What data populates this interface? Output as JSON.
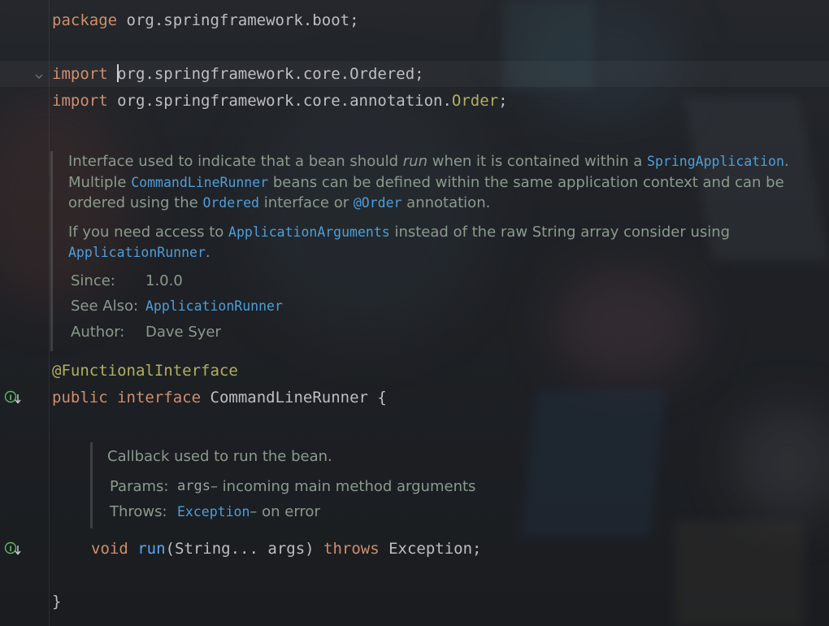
{
  "code": {
    "package_kw": "package",
    "package_name": "org.springframework.boot;",
    "import1_kw": "import",
    "import1_path": "org.springframework.core.Ordered;",
    "import2_kw": "import",
    "import2_path": "org.springframework.core.annotation.",
    "import2_class": "Order",
    "import2_semi": ";",
    "annotation": "@FunctionalInterface",
    "public_kw": "public",
    "interface_kw": "interface",
    "interface_name": "CommandLineRunner",
    "open_brace": "{",
    "void_kw": "void",
    "method_name": "run",
    "method_params": "(String... args) ",
    "throws_kw": "throws",
    "exception_type": "Exception;",
    "close_brace": "}"
  },
  "class_doc": {
    "p1_a": "Interface used to indicate that a bean should ",
    "p1_run": "run",
    "p1_b": " when it is contained within a ",
    "p1_spring_app": "SpringApplication",
    "p1_c": ".",
    "p1_multiple": "Multiple ",
    "p1_clr": "CommandLineRunner",
    "p1_d": " beans can be defined within the same application context and can be ordered using the ",
    "p1_ordered": "Ordered",
    "p1_e": " interface or ",
    "p1_order_ann": "@Order",
    "p1_f": " annotation.",
    "p2_a": "If you need access to ",
    "p2_app_args": "ApplicationArguments",
    "p2_b": " instead of the raw String array consider using ",
    "p2_app_runner": "ApplicationRunner",
    "p2_c": ".",
    "since_label": "Since:",
    "since_value": "1.0.0",
    "see_also_label": "See Also:",
    "see_also_value": "ApplicationRunner",
    "author_label": "Author:",
    "author_value": "Dave Syer"
  },
  "method_doc": {
    "summary": "Callback used to run the bean.",
    "params_label": "Params:",
    "param_name": "args",
    "param_desc": " – incoming main method arguments",
    "throws_label": "Throws:",
    "throws_type": "Exception",
    "throws_desc": " – on error"
  },
  "colors": {
    "keyword": "#cf8e6d",
    "annotation": "#b3ae60",
    "method": "#56a8f5",
    "doc_text": "#8b9a8c",
    "doc_link": "#4e9ed8",
    "gutter_icon": "#5fb865"
  },
  "icons": {
    "fold": "chevron-down-icon",
    "implementation": "implemented-interface-icon"
  }
}
